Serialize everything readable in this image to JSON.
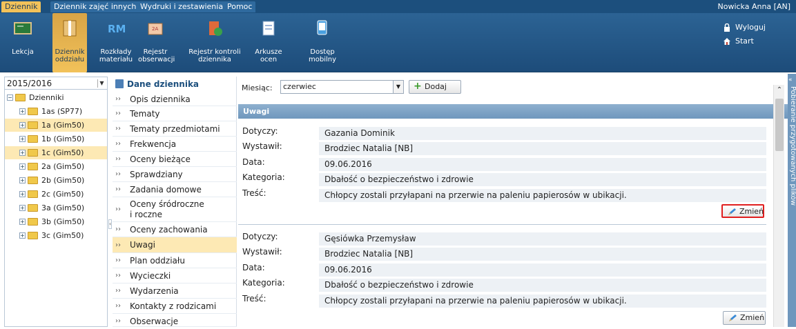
{
  "menubar": {
    "tabs": [
      "Dziennik",
      "Dziennik zajęć innych",
      "Wydruki i zestawienia",
      "Pomoc"
    ],
    "user": "Nowicka Anna [AN]"
  },
  "ribbon": {
    "buttons": [
      {
        "label1": "Lekcja",
        "label2": "",
        "icon": "board-icon"
      },
      {
        "label1": "Dziennik",
        "label2": "oddziału",
        "icon": "class-journal-icon"
      },
      {
        "label1": "Rozkłady",
        "label2": "materiału",
        "icon": "rm-icon"
      },
      {
        "label1": "Rejestr",
        "label2": "obserwacji",
        "icon": "observation-register-icon"
      },
      {
        "label1": "Rejestr kontroli",
        "label2": "dziennika",
        "icon": "control-register-icon"
      },
      {
        "label1": "Arkusze",
        "label2": "ocen",
        "icon": "grade-sheet-icon"
      },
      {
        "label1": "Dostęp",
        "label2": "mobilny",
        "icon": "mobile-access-icon"
      }
    ],
    "logout": "Wyloguj",
    "start": "Start"
  },
  "tree": {
    "year": "2015/2016",
    "root": "Dzienniki",
    "items": [
      "1as (SP77)",
      "1a (Gim50)",
      "1b (Gim50)",
      "1c (Gim50)",
      "2a (Gim50)",
      "2b (Gim50)",
      "2c (Gim50)",
      "3a (Gim50)",
      "3b (Gim50)",
      "3c (Gim50)"
    ]
  },
  "nav": {
    "title": "Dane dziennika",
    "items": [
      "Opis dziennika",
      "Tematy",
      "Tematy przedmiotami",
      "Frekwencja",
      "Oceny bieżące",
      "Sprawdziany",
      "Zadania domowe",
      "Oceny śródroczne",
      "i roczne",
      "Oceny zachowania",
      "Uwagi",
      "Plan oddziału",
      "Wycieczki",
      "Wydarzenia",
      "Kontakty z rodzicami",
      "Obserwacje"
    ]
  },
  "main": {
    "month_label": "Miesiąc:",
    "month_value": "czerwiec",
    "add_label": "Dodaj",
    "section_title": "Uwagi",
    "field_labels": [
      "Dotyczy:",
      "Wystawił:",
      "Data:",
      "Kategoria:",
      "Treść:"
    ],
    "edit_label": "Zmień",
    "records": [
      {
        "dotyczy": "Gazania Dominik",
        "wystawil": "Brodziec Natalia [NB]",
        "data": "09.06.2016",
        "kategoria": "Dbałość o bezpieczeństwo i zdrowie",
        "tresc": "Chłopcy zostali przyłapani na przerwie na paleniu papierosów w ubikacji."
      },
      {
        "dotyczy": "Gęsiówka Przemysław",
        "wystawil": "Brodziec Natalia [NB]",
        "data": "09.06.2016",
        "kategoria": "Dbałość o bezpieczeństwo i zdrowie",
        "tresc": "Chłopcy zostali przyłapani na przerwie na paleniu papierosów w ubikacji."
      }
    ]
  },
  "side_panel": {
    "label": "Pobieranie przygotowanych plików"
  }
}
